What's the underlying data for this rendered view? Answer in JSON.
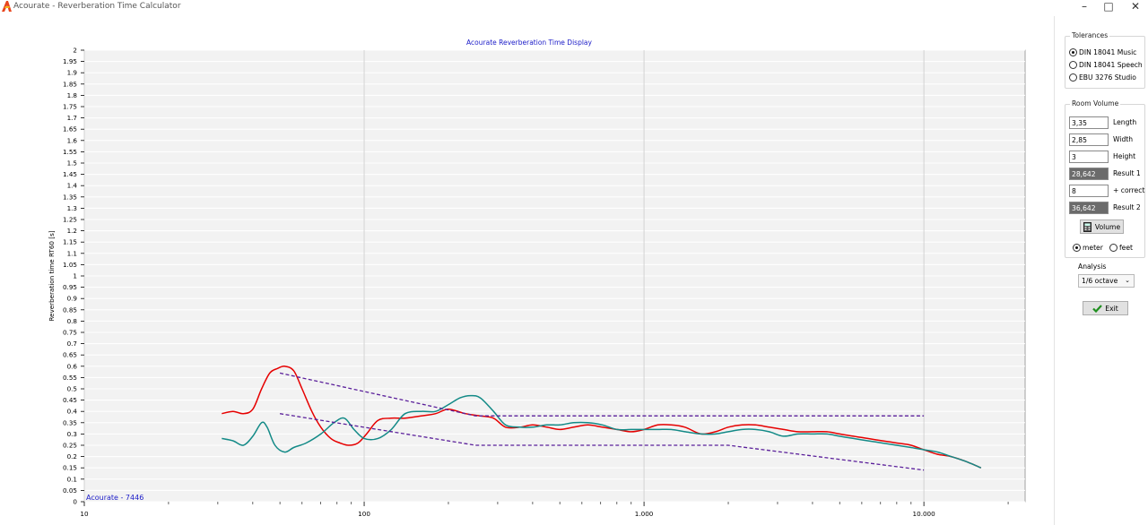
{
  "window": {
    "title": "Acourate - Reverberation Time Calculator",
    "minimize_icon": "minimize-icon",
    "maximize_icon": "maximize-icon",
    "close_icon": "close-icon"
  },
  "chart_data": {
    "type": "line",
    "title": "Acourate Reverberation Time Display",
    "watermark": "Acourate - 7446",
    "ylabel": "Reverberation time RT60 [s]",
    "xlabel": "",
    "xscale": "log",
    "xlim": [
      10,
      23000
    ],
    "ylim": [
      0,
      2
    ],
    "x_tick_labels": [
      {
        "value": 10,
        "label": "10"
      },
      {
        "value": 100,
        "label": "100"
      },
      {
        "value": 1000,
        "label": "1.000"
      },
      {
        "value": 10000,
        "label": "10.000"
      }
    ],
    "y_ticks": [
      0,
      0.05,
      0.1,
      0.15,
      0.2,
      0.25,
      0.3,
      0.35,
      0.4,
      0.45,
      0.5,
      0.55,
      0.6,
      0.65,
      0.7,
      0.75,
      0.8,
      0.85,
      0.9,
      0.95,
      1,
      1.05,
      1.1,
      1.15,
      1.2,
      1.25,
      1.3,
      1.35,
      1.4,
      1.45,
      1.5,
      1.55,
      1.6,
      1.65,
      1.7,
      1.75,
      1.8,
      1.85,
      1.9,
      1.95,
      2
    ],
    "grid": true,
    "series": [
      {
        "color": "#e60000",
        "style": "solid",
        "x": [
          31,
          34,
          37,
          40,
          43,
          46,
          49,
          52,
          56,
          60,
          65,
          70,
          76,
          82,
          88,
          95,
          102,
          112,
          125,
          140,
          160,
          180,
          200,
          230,
          260,
          290,
          320,
          360,
          400,
          450,
          500,
          560,
          630,
          710,
          800,
          900,
          1000,
          1120,
          1250,
          1400,
          1600,
          1800,
          2000,
          2240,
          2500,
          2800,
          3150,
          3550,
          4000,
          4500,
          5000,
          5600,
          6300,
          7100,
          8000,
          9000,
          10000,
          11200,
          12500,
          14000,
          16000
        ],
        "y": [
          0.39,
          0.4,
          0.39,
          0.41,
          0.5,
          0.57,
          0.59,
          0.6,
          0.58,
          0.5,
          0.4,
          0.33,
          0.28,
          0.26,
          0.25,
          0.26,
          0.3,
          0.36,
          0.37,
          0.37,
          0.38,
          0.39,
          0.41,
          0.39,
          0.38,
          0.37,
          0.33,
          0.33,
          0.34,
          0.33,
          0.32,
          0.33,
          0.34,
          0.33,
          0.32,
          0.31,
          0.32,
          0.34,
          0.34,
          0.33,
          0.3,
          0.31,
          0.33,
          0.34,
          0.34,
          0.33,
          0.32,
          0.31,
          0.31,
          0.31,
          0.3,
          0.29,
          0.28,
          0.27,
          0.26,
          0.25,
          0.23,
          0.21,
          0.2,
          0.18,
          0.15
        ]
      },
      {
        "color": "#138a87",
        "style": "solid",
        "x": [
          31,
          34,
          37,
          40,
          43,
          45,
          48,
          52,
          56,
          62,
          70,
          78,
          85,
          92,
          100,
          112,
          125,
          140,
          160,
          180,
          200,
          220,
          240,
          260,
          290,
          320,
          360,
          400,
          450,
          500,
          560,
          630,
          710,
          800,
          900,
          1000,
          1120,
          1250,
          1400,
          1600,
          1800,
          2000,
          2240,
          2500,
          2800,
          3150,
          3550,
          4000,
          4500,
          5000,
          5600,
          6300,
          7100,
          8000,
          9000,
          10000,
          11200,
          12500,
          14000,
          16000
        ],
        "y": [
          0.28,
          0.27,
          0.25,
          0.29,
          0.35,
          0.33,
          0.25,
          0.22,
          0.24,
          0.26,
          0.3,
          0.35,
          0.37,
          0.32,
          0.28,
          0.28,
          0.32,
          0.39,
          0.4,
          0.4,
          0.43,
          0.46,
          0.47,
          0.46,
          0.4,
          0.34,
          0.33,
          0.33,
          0.34,
          0.34,
          0.35,
          0.35,
          0.34,
          0.32,
          0.32,
          0.32,
          0.32,
          0.32,
          0.31,
          0.3,
          0.3,
          0.31,
          0.32,
          0.32,
          0.31,
          0.29,
          0.3,
          0.3,
          0.3,
          0.29,
          0.28,
          0.27,
          0.26,
          0.25,
          0.24,
          0.23,
          0.22,
          0.2,
          0.18,
          0.15
        ]
      },
      {
        "color": "#5a1f9a",
        "style": "dashed",
        "x": [
          50,
          250,
          10000
        ],
        "y": [
          0.57,
          0.38,
          0.38
        ]
      },
      {
        "color": "#5a1f9a",
        "style": "dashed",
        "x": [
          50,
          250,
          2000,
          10000
        ],
        "y": [
          0.39,
          0.25,
          0.25,
          0.14
        ]
      }
    ]
  },
  "sidebar": {
    "tolerances": {
      "title": "Tolerances",
      "options": [
        "DIN 18041 Music",
        "DIN 18041 Speech",
        "EBU 3276 Studio"
      ],
      "selected": 0
    },
    "room_volume": {
      "title": "Room Volume",
      "length_value": "3,35",
      "length_label": "Length",
      "width_value": "2,85",
      "width_label": "Width",
      "height_value": "3",
      "height_label": "Height",
      "result1_value": "28,642",
      "result1_label": "Result 1",
      "correct_value": "8",
      "correct_label": "+ correct",
      "result2_value": "36,642",
      "result2_label": "Result 2",
      "volume_button": "Volume",
      "volume_icon": "calculator-icon",
      "units": [
        "meter",
        "feet"
      ],
      "selected_unit": 0
    },
    "analysis": {
      "label": "Analysis",
      "selected": "1/6 octave"
    },
    "exit_button": "Exit",
    "exit_icon": "checkmark-icon"
  }
}
